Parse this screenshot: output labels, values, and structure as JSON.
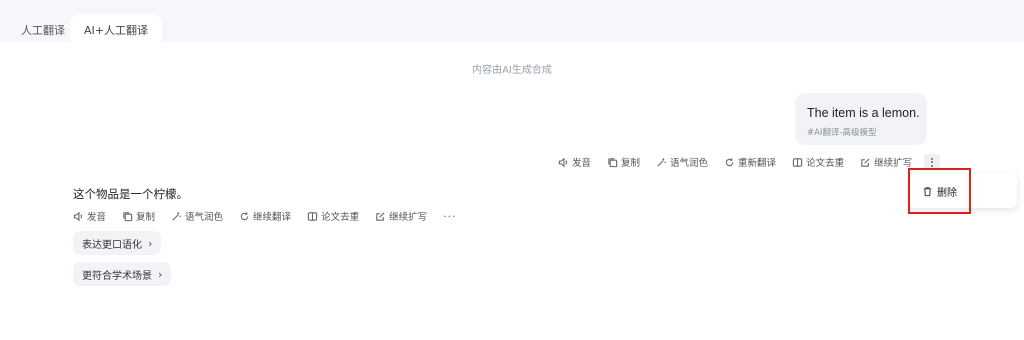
{
  "tabs": [
    {
      "label": "人工翻译"
    },
    {
      "label": "AI+人工翻译"
    }
  ],
  "notice": "内容由AI生成合成",
  "user_message": {
    "text": "The item is a lemon.",
    "tag": "#AI翻译-高级模型"
  },
  "message_actions": {
    "speak": "发音",
    "copy": "复制",
    "tone": "语气润色",
    "retranslate": "重新翻译",
    "dedupe": "论文去重",
    "expand": "继续扩写"
  },
  "result": {
    "text": "这个物品是一个柠檬。"
  },
  "result_actions": {
    "speak": "发音",
    "copy": "复制",
    "tone": "语气润色",
    "continue": "继续翻译",
    "dedupe": "论文去重",
    "expand": "继续扩写",
    "more": "···"
  },
  "suggestions": [
    {
      "label": "表达更口语化"
    },
    {
      "label": "更符合学术场景"
    }
  ],
  "context_menu": {
    "delete_label": "删除"
  },
  "colors": {
    "highlight": "#e0201e",
    "bubble_bg": "#f2f3f7",
    "top_bar": "#f5f7fb"
  }
}
